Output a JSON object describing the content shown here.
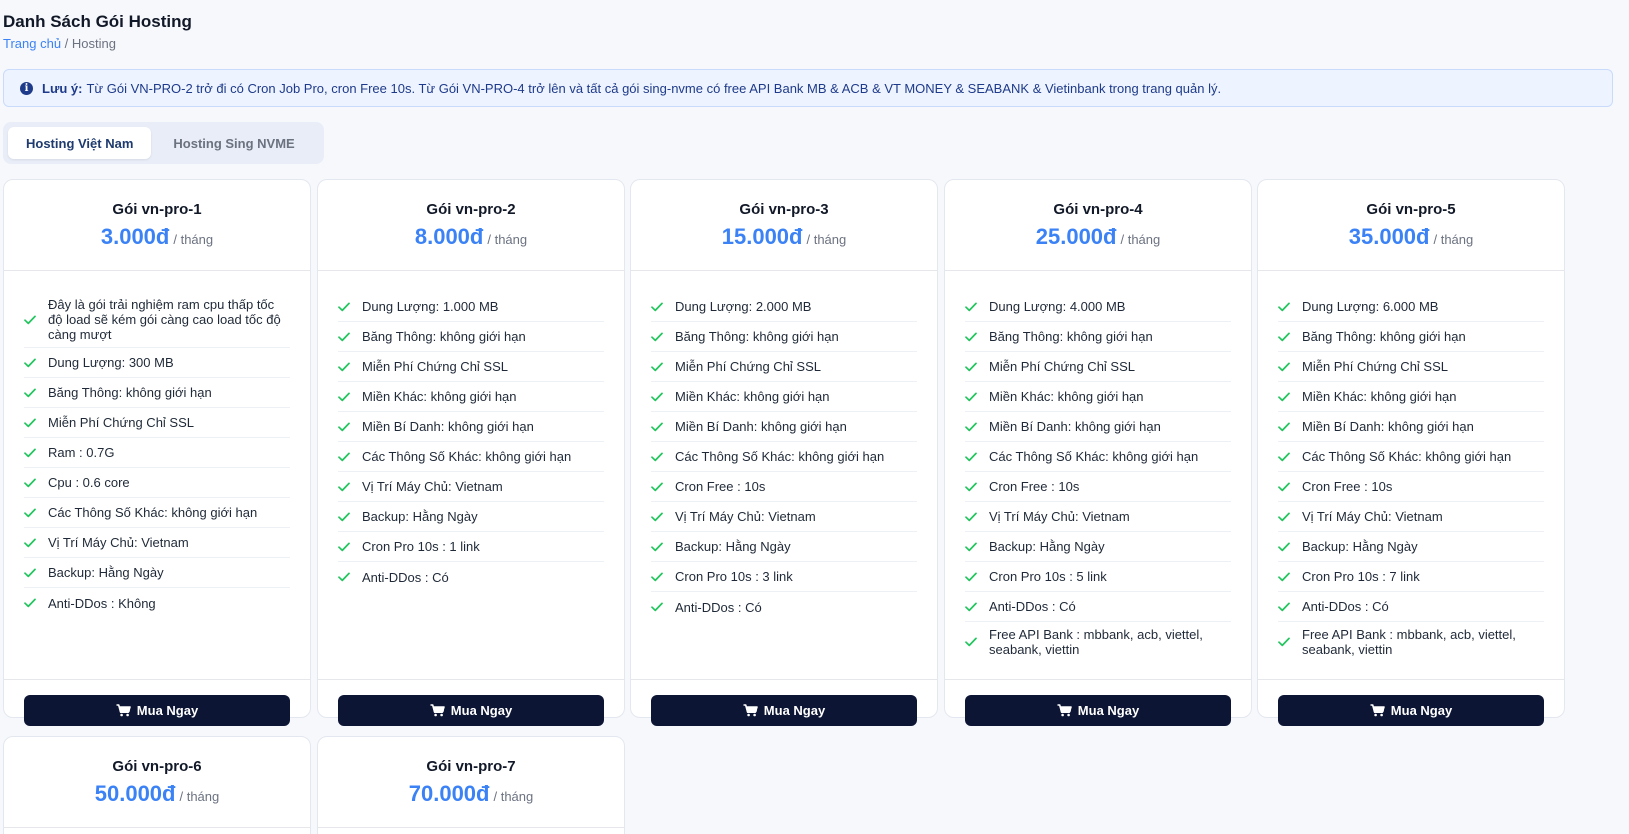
{
  "page": {
    "title": "Danh Sách Gói Hosting",
    "breadcrumb": {
      "home": "Trang chủ",
      "separator": " / ",
      "current": "Hosting"
    }
  },
  "notice": {
    "icon": "info-icon",
    "label": "Lưu ý:",
    "text": "Từ Gói VN-PRO-2 trở đi có Cron Job Pro, cron Free 10s. Từ Gói VN-PRO-4 trở lên và tất cả gói sing-nvme có free API Bank MB & ACB & VT MONEY & SEABANK & Vietinbank trong trang quản lý."
  },
  "tabs": [
    {
      "label": "Hosting Việt Nam",
      "active": true
    },
    {
      "label": "Hosting Sing NVME",
      "active": false
    }
  ],
  "colors": {
    "accent": "#3b82f6",
    "check": "#22c55e",
    "button": "#0c1534"
  },
  "buy_label": "Mua Ngay",
  "per_label": "/ tháng",
  "plans": [
    {
      "name": "Gói vn-pro-1",
      "price": "3.000đ",
      "features": [
        "Đây là gói trải nghiệm ram cpu thấp tốc độ load sẽ kém gói càng cao load tốc độ càng mượt",
        "Dung Lượng: 300 MB",
        "Băng Thông: không giới hạn",
        "Miễn Phí Chứng Chỉ SSL",
        "Ram : 0.7G",
        "Cpu : 0.6 core",
        "Các Thông Số Khác: không giới hạn",
        "Vị Trí Máy Chủ: Vietnam",
        "Backup: Hằng Ngày",
        "Anti-DDos : Không"
      ]
    },
    {
      "name": "Gói vn-pro-2",
      "price": "8.000đ",
      "features": [
        "Dung Lượng: 1.000 MB",
        "Băng Thông: không giới hạn",
        "Miễn Phí Chứng Chỉ SSL",
        "Miền Khác: không giới hạn",
        "Miền Bí Danh: không giới hạn",
        "Các Thông Số Khác: không giới hạn",
        "Vị Trí Máy Chủ: Vietnam",
        "Backup: Hằng Ngày",
        "Cron Pro 10s : 1 link",
        "Anti-DDos : Có"
      ]
    },
    {
      "name": "Gói vn-pro-3",
      "price": "15.000đ",
      "features": [
        "Dung Lượng: 2.000 MB",
        "Băng Thông: không giới hạn",
        "Miễn Phí Chứng Chỉ SSL",
        "Miền Khác: không giới hạn",
        "Miền Bí Danh: không giới hạn",
        "Các Thông Số Khác: không giới hạn",
        "Cron Free : 10s",
        "Vị Trí Máy Chủ: Vietnam",
        "Backup: Hằng Ngày",
        "Cron Pro 10s : 3 link",
        "Anti-DDos : Có"
      ]
    },
    {
      "name": "Gói vn-pro-4",
      "price": "25.000đ",
      "features": [
        "Dung Lượng: 4.000 MB",
        "Băng Thông: không giới hạn",
        "Miễn Phí Chứng Chỉ SSL",
        "Miền Khác: không giới hạn",
        "Miền Bí Danh: không giới hạn",
        "Các Thông Số Khác: không giới hạn",
        "Cron Free : 10s",
        "Vị Trí Máy Chủ: Vietnam",
        "Backup: Hằng Ngày",
        "Cron Pro 10s : 5 link",
        "Anti-DDos : Có",
        "Free API Bank : mbbank, acb, viettel, seabank, viettin"
      ]
    },
    {
      "name": "Gói vn-pro-5",
      "price": "35.000đ",
      "features": [
        "Dung Lượng: 6.000 MB",
        "Băng Thông: không giới hạn",
        "Miễn Phí Chứng Chỉ SSL",
        "Miền Khác: không giới hạn",
        "Miền Bí Danh: không giới hạn",
        "Các Thông Số Khác: không giới hạn",
        "Cron Free : 10s",
        "Vị Trí Máy Chủ: Vietnam",
        "Backup: Hằng Ngày",
        "Cron Pro 10s : 7 link",
        "Anti-DDos : Có",
        "Free API Bank : mbbank, acb, viettel, seabank, viettin"
      ]
    },
    {
      "name": "Gói vn-pro-6",
      "price": "50.000đ",
      "features": []
    },
    {
      "name": "Gói vn-pro-7",
      "price": "70.000đ",
      "features": []
    }
  ]
}
